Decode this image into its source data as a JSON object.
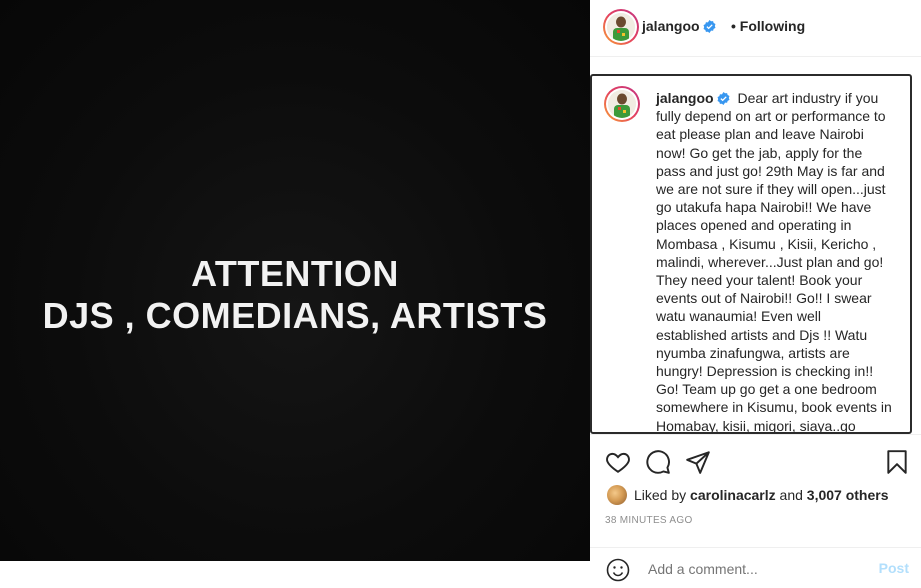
{
  "media": {
    "line1": "ATTENTION",
    "line2": "DJS , COMEDIANS, ARTISTS"
  },
  "header": {
    "username": "jalangoo",
    "separator": "•",
    "following": "Following"
  },
  "caption": {
    "username": "jalangoo",
    "text": "Dear art industry if you fully depend on art or performance to eat please plan and leave Nairobi now! Go get the jab, apply for the pass and just go! 29th May is far and we are not sure if they will open...just go utakufa hapa Nairobi!! We have places opened and operating in Mombasa , Kisumu , Kisii, Kericho , malindi, wherever...Just plan and go! They need your talent! Book your events out of Nairobi!! Go!! I swear watu wanaumia! Even well established artists and Djs !! Watu nyumba zinafungwa, artists are hungry! Depression is checking in!! Go! Team up go get a one bedroom somewhere in Kisumu, book events in Homabay, kisii, migori, siaya..go create a new"
  },
  "likes": {
    "prefix": "Liked by",
    "user": "carolinacarlz",
    "middle": "and",
    "others": "3,007 others"
  },
  "timestamp": "38 MINUTES AGO",
  "comment": {
    "placeholder": "Add a comment...",
    "post_label": "Post"
  },
  "colors": {
    "verified": "#3897f0",
    "media_bg": "#0c0c0c"
  },
  "icons": [
    "verified-badge-icon",
    "heart-icon",
    "comment-icon",
    "share-icon",
    "bookmark-icon",
    "emoji-icon"
  ]
}
